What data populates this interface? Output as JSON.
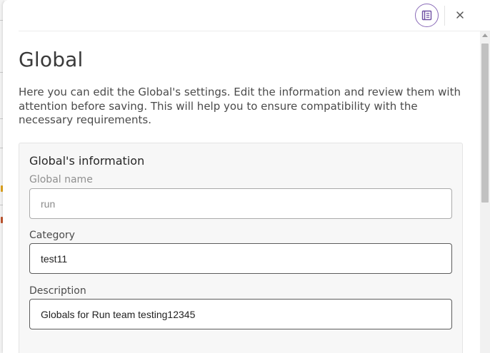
{
  "header": {
    "doc_icon": "document-list-icon",
    "close_icon": "close-icon",
    "close_glyph": "×"
  },
  "page": {
    "title": "Global",
    "intro": "Here you can edit the Global's settings. Edit the information and review them with attention before saving. This will help you to ensure compatibility with the necessary requirements."
  },
  "info_card": {
    "title": "Global's information",
    "fields": [
      {
        "label": "Global name",
        "value": "run",
        "disabled": true
      },
      {
        "label": "Category",
        "value": "test11",
        "disabled": false
      },
      {
        "label": "Description",
        "value": "Globals for Run team testing12345",
        "disabled": false
      }
    ]
  },
  "colors": {
    "accent_purple": "#8a6bb8",
    "field_border": "#5c5c5c",
    "card_background": "#f7f7f7"
  }
}
